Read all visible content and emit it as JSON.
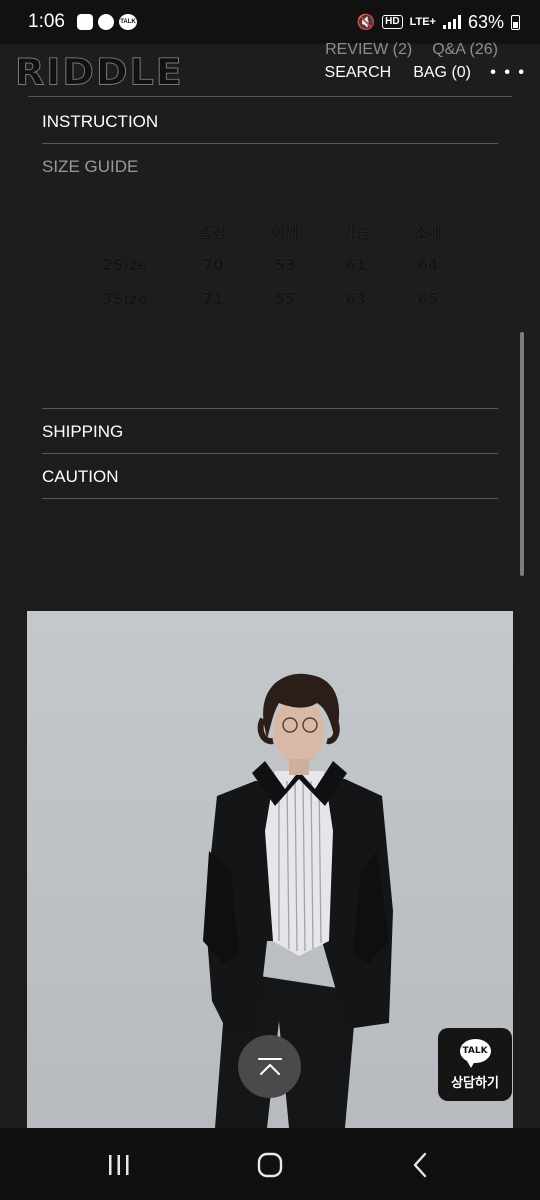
{
  "status_bar": {
    "time": "1:06",
    "left_icons": [
      "gallery-icon",
      "chat-bubble-icon",
      "kakaotalk-icon"
    ],
    "talk_icon_text": "TALK",
    "mute_icon": "vibrate-mute-icon",
    "hd_badge": "HD",
    "network": "LTE+",
    "battery": "63%"
  },
  "header": {
    "logo": "RIDDLE",
    "review_link": "REVIEW (2)",
    "qa_link": "Q&A (26)",
    "search_link": "SEARCH",
    "bag_link": "BAG (0)",
    "more_icon": "more-dots-icon",
    "more_label": "• • •"
  },
  "accordion": {
    "instruction": "INSTRUCTION",
    "size_guide": "SIZE GUIDE",
    "shipping": "SHIPPING",
    "caution": "CAUTION"
  },
  "size_table": {
    "headers": [
      "총장",
      "어깨",
      "가슴",
      "소매"
    ],
    "rows": [
      {
        "size": "2Size",
        "values": [
          "70",
          "53",
          "61",
          "64"
        ]
      },
      {
        "size": "3Size",
        "values": [
          "71",
          "55",
          "63",
          "65"
        ]
      }
    ]
  },
  "floating": {
    "scroll_top_icon": "chevron-up-icon",
    "talk_bubble": "TALK",
    "talk_label": "상담하기"
  },
  "nav_bar": {
    "recents_icon": "recents-icon",
    "home_icon": "home-icon",
    "back_icon": "back-icon"
  },
  "colors": {
    "background": "#1d1d1d",
    "photo_backdrop": "#bfc3c7"
  }
}
